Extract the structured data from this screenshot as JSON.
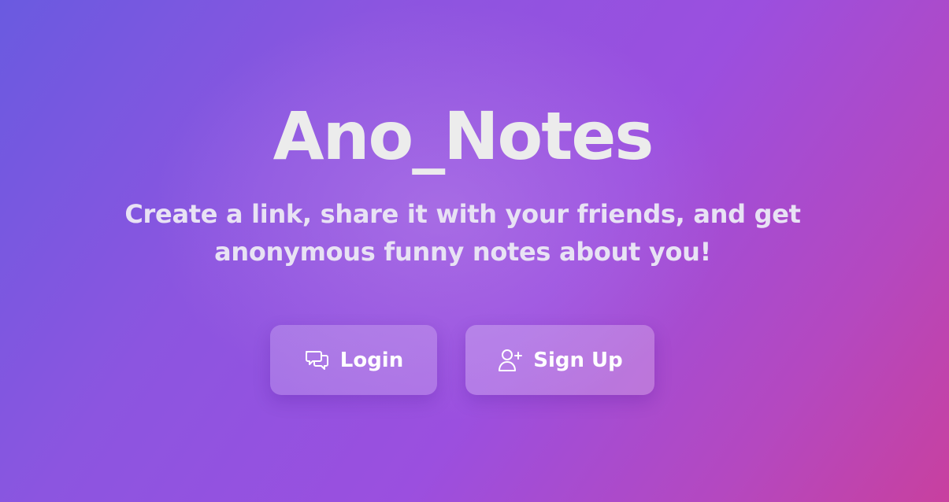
{
  "app": {
    "title": "Ano_Notes",
    "tagline": "Create a link, share it with your friends, and get anonymous funny notes about you!"
  },
  "actions": {
    "login": {
      "label": "Login",
      "icon": "chat-bubbles-icon"
    },
    "signup": {
      "label": "Sign Up",
      "icon": "user-plus-icon"
    }
  },
  "colors": {
    "gradient_start": "#6a5ae0",
    "gradient_mid": "#9b4fdf",
    "gradient_end": "#c8409f",
    "title_text": "#ececec",
    "button_text": "#ffffff"
  }
}
